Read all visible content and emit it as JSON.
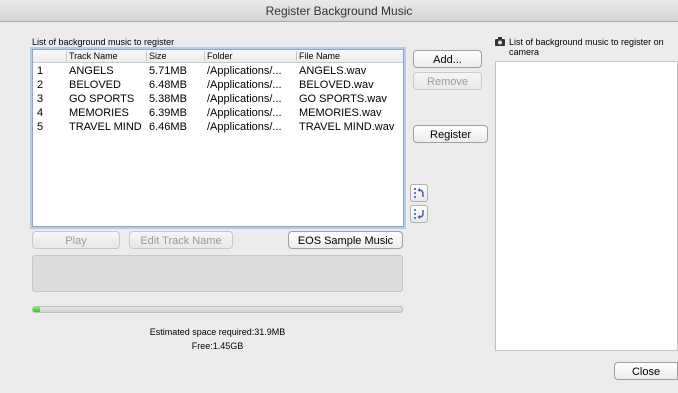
{
  "window": {
    "title": "Register Background Music"
  },
  "left_panel": {
    "list_label": "List of background music to register",
    "columns": [
      "",
      "Track Name",
      "Size",
      "Folder",
      "File Name"
    ],
    "rows": [
      {
        "num": "1",
        "track": "ANGELS",
        "size": "5.71MB",
        "folder": "/Applications/...",
        "file": "ANGELS.wav"
      },
      {
        "num": "2",
        "track": "BELOVED",
        "size": "6.48MB",
        "folder": "/Applications/...",
        "file": "BELOVED.wav"
      },
      {
        "num": "3",
        "track": "GO SPORTS",
        "size": "5.38MB",
        "folder": "/Applications/...",
        "file": "GO SPORTS.wav"
      },
      {
        "num": "4",
        "track": "MEMORIES",
        "size": "6.39MB",
        "folder": "/Applications/...",
        "file": "MEMORIES.wav"
      },
      {
        "num": "5",
        "track": "TRAVEL MIND",
        "size": "6.46MB",
        "folder": "/Applications/...",
        "file": "TRAVEL MIND.wav"
      }
    ],
    "buttons": {
      "play": "Play",
      "edit": "Edit Track Name",
      "eos": "EOS Sample Music"
    },
    "progress": 0.02,
    "estimated": "Estimated space required:31.9MB",
    "free": "Free:1.45GB"
  },
  "middle": {
    "add": "Add...",
    "remove": "Remove",
    "register": "Register"
  },
  "right_panel": {
    "list_label_line1": "List of background music to register on",
    "list_label_line2": "camera"
  },
  "footer": {
    "close": "Close"
  },
  "icons": {
    "camera": "camera-icon",
    "move_up": "move-up-icon",
    "move_down": "move-down-icon"
  }
}
